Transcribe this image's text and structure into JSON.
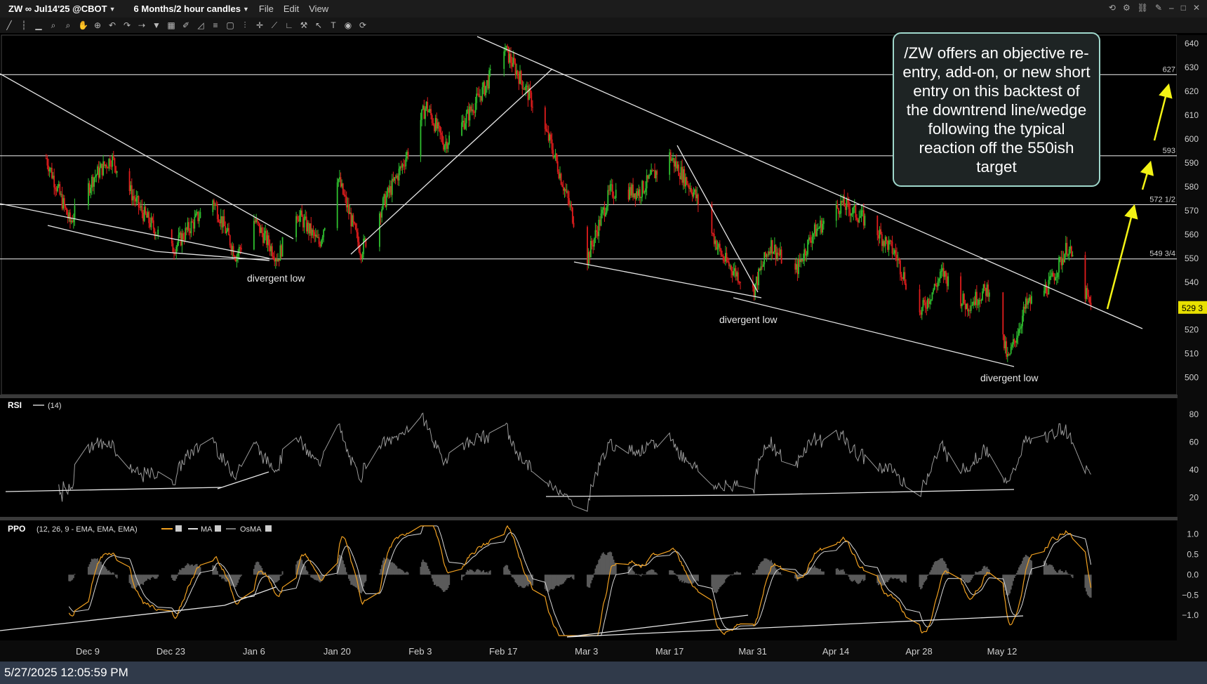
{
  "header": {
    "symbol": "ZW ∞ Jul14'25 @CBOT",
    "timeframe": "6 Months/2 hour candles",
    "menus": [
      "File",
      "Edit",
      "View"
    ]
  },
  "callout": {
    "text": "/ZW offers an objective re-entry, add-on, or new short entry on this backtest of the downtrend line/wedge following the typical reaction off the 550ish target"
  },
  "status": {
    "timestamp": "5/27/2025 12:05:59 PM"
  },
  "colors": {
    "bull": "#2fbf2f",
    "bear": "#e11d1d",
    "arrow": "#f3f315",
    "rsi": "#9a9a9a",
    "ppo": "#f0a020",
    "ma": "#d8d8d8",
    "osma": "#5a5a5a"
  },
  "chart_data": [
    {
      "type": "candlestick",
      "panel": "price",
      "x_tick_labels": [
        "Dec 9",
        "Dec 23",
        "Jan 6",
        "Jan 20",
        "Feb 3",
        "Feb 17",
        "Mar 3",
        "Mar 17",
        "Mar 31",
        "Apr 14",
        "Apr 28",
        "May 12"
      ],
      "y_ticks": [
        500,
        510,
        520,
        530,
        540,
        550,
        560,
        570,
        580,
        590,
        600,
        610,
        620,
        630,
        640
      ],
      "ylim": [
        494,
        643
      ],
      "last_price_label": "529 3",
      "levels": [
        {
          "value": 627,
          "label": "627"
        },
        {
          "value": 593,
          "label": "593"
        },
        {
          "value": 572.5,
          "label": "572 1/2"
        },
        {
          "value": 549.75,
          "label": "549 3/4"
        }
      ],
      "annotations": [
        "divergent low",
        "divergent low",
        "divergent low"
      ],
      "approx_price_path": [
        [
          "Dec 2",
          592
        ],
        [
          "Dec 6",
          565
        ],
        [
          "Dec 10",
          584
        ],
        [
          "Dec 13",
          592
        ],
        [
          "Dec 18",
          570
        ],
        [
          "Dec 23",
          553
        ],
        [
          "Dec 30",
          575
        ],
        [
          "Jan 3",
          551
        ],
        [
          "Jan 6",
          566
        ],
        [
          "Jan 10",
          550
        ],
        [
          "Jan 13",
          570
        ],
        [
          "Jan 17",
          556
        ],
        [
          "Jan 20",
          585
        ],
        [
          "Jan 24",
          553
        ],
        [
          "Jan 28",
          574
        ],
        [
          "Jan 31",
          589
        ],
        [
          "Feb 4",
          614
        ],
        [
          "Feb 7",
          598
        ],
        [
          "Feb 10",
          606
        ],
        [
          "Feb 14",
          622
        ],
        [
          "Feb 17",
          639
        ],
        [
          "Feb 21",
          620
        ],
        [
          "Feb 25",
          598
        ],
        [
          "Mar 1",
          565
        ],
        [
          "Mar 3",
          549
        ],
        [
          "Mar 7",
          578
        ],
        [
          "Mar 12",
          578
        ],
        [
          "Mar 17",
          593
        ],
        [
          "Mar 21",
          578
        ],
        [
          "Mar 26",
          550
        ],
        [
          "Mar 31",
          536
        ],
        [
          "Apr 3",
          556
        ],
        [
          "Apr 7",
          543
        ],
        [
          "Apr 10",
          560
        ],
        [
          "Apr 15",
          573
        ],
        [
          "Apr 20",
          564
        ],
        [
          "Apr 24",
          552
        ],
        [
          "Apr 28",
          526
        ],
        [
          "May 2",
          544
        ],
        [
          "May 6",
          530
        ],
        [
          "May 10",
          538
        ],
        [
          "May 13",
          507
        ],
        [
          "May 16",
          530
        ],
        [
          "May 20",
          539
        ],
        [
          "May 23",
          555
        ],
        [
          "May 27",
          529
        ]
      ]
    },
    {
      "type": "line",
      "panel": "RSI",
      "title": "RSI",
      "params": "(14)",
      "y_ticks": [
        20,
        40,
        60,
        80
      ],
      "ylim": [
        8,
        90
      ]
    },
    {
      "type": "line",
      "panel": "PPO",
      "title": "PPO",
      "params": "(12, 26, 9 - EMA, EMA, EMA)",
      "legend": [
        "MA",
        "OsMA"
      ],
      "y_ticks": [
        "1.0",
        "0.5",
        "0.0",
        "−0.5",
        "−1.0"
      ],
      "ylim": [
        -1.55,
        1.25
      ]
    }
  ]
}
